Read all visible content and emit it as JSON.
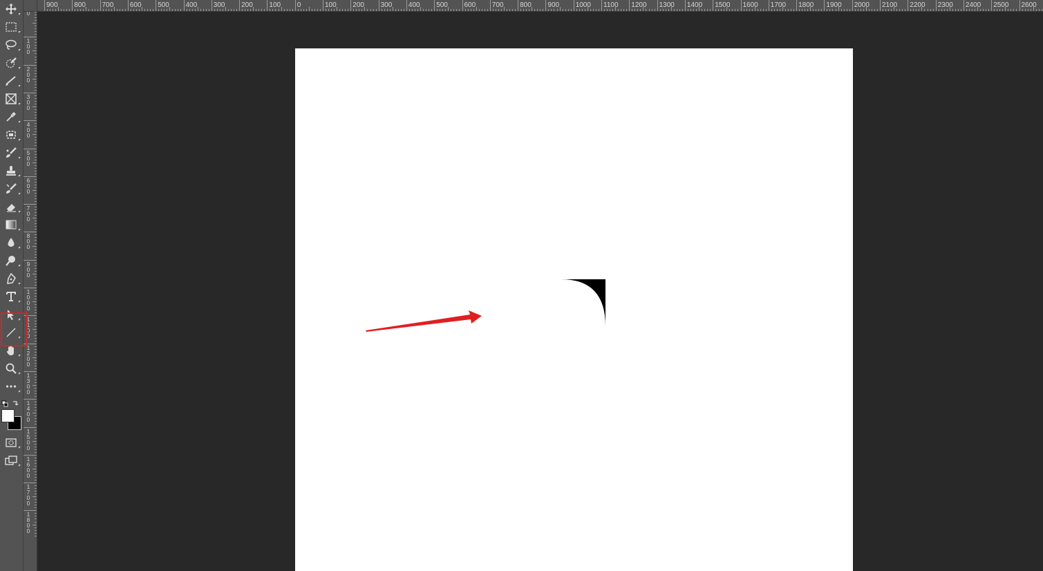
{
  "toolbar": {
    "tools": [
      {
        "name": "move-tool-icon"
      },
      {
        "name": "rectangular-marquee-tool-icon"
      },
      {
        "name": "lasso-tool-icon"
      },
      {
        "name": "quick-selection-tool-icon"
      },
      {
        "name": "crop-tool-icon"
      },
      {
        "name": "frame-tool-icon"
      },
      {
        "name": "eyedropper-tool-icon"
      },
      {
        "name": "spot-healing-brush-icon"
      },
      {
        "name": "brush-tool-icon"
      },
      {
        "name": "clone-stamp-icon"
      },
      {
        "name": "history-brush-icon"
      },
      {
        "name": "eraser-tool-icon"
      },
      {
        "name": "gradient-tool-icon"
      },
      {
        "name": "blur-tool-icon"
      },
      {
        "name": "dodge-tool-icon"
      },
      {
        "name": "pen-tool-icon"
      },
      {
        "name": "type-tool-icon",
        "glyph": "T"
      },
      {
        "name": "path-selection-tool-icon"
      },
      {
        "name": "line-tool-icon"
      },
      {
        "name": "hand-tool-icon"
      },
      {
        "name": "zoom-tool-icon"
      },
      {
        "name": "edit-toolbar-icon",
        "glyph": "•••"
      },
      {
        "name": "default-colors-icon"
      },
      {
        "name": "color-swatches-icon"
      },
      {
        "name": "quick-mask-icon"
      },
      {
        "name": "screen-mode-icon"
      }
    ],
    "selected_tool": "line-tool-icon",
    "foreground_color": "#ffffff",
    "background_color": "#000000"
  },
  "rulers": {
    "horizontal_labels": [
      "900",
      "800",
      "700",
      "600",
      "500",
      "400",
      "300",
      "200",
      "100",
      "0",
      "100",
      "200",
      "300",
      "400",
      "500",
      "600",
      "700",
      "800",
      "900",
      "1000",
      "1100",
      "1200",
      "1300",
      "1400",
      "1500",
      "1600",
      "1700",
      "1800",
      "1900",
      "2000",
      "2100",
      "2200",
      "2300",
      "2400",
      "2500",
      "2600"
    ],
    "vertical_labels": [
      "0",
      "100",
      "200",
      "300",
      "400",
      "500",
      "600",
      "700",
      "800",
      "900",
      "1000",
      "1100",
      "1200",
      "1300",
      "1400",
      "1500",
      "1600",
      "1700",
      "1800"
    ]
  },
  "document": {
    "background": "#ffffff",
    "shape_color": "#000000",
    "annotation_color": "#e02020"
  }
}
